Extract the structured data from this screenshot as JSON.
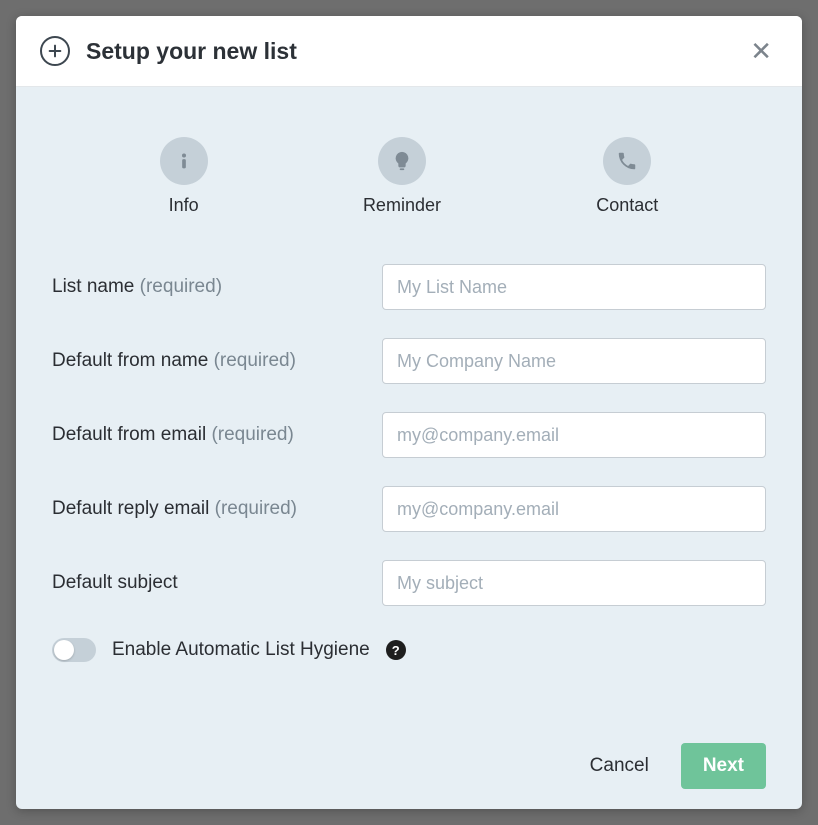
{
  "header": {
    "title": "Setup your new list"
  },
  "steps": [
    {
      "label": "Info",
      "icon": "info-icon"
    },
    {
      "label": "Reminder",
      "icon": "lightbulb-icon"
    },
    {
      "label": "Contact",
      "icon": "phone-icon"
    }
  ],
  "fields": {
    "list_name": {
      "label": "List name",
      "required_text": "(required)",
      "placeholder": "My List Name",
      "value": ""
    },
    "from_name": {
      "label": "Default from name",
      "required_text": "(required)",
      "placeholder": "My Company Name",
      "value": ""
    },
    "from_email": {
      "label": "Default from email",
      "required_text": "(required)",
      "placeholder": "my@company.email",
      "value": ""
    },
    "reply_email": {
      "label": "Default reply email",
      "required_text": "(required)",
      "placeholder": "my@company.email",
      "value": ""
    },
    "subject": {
      "label": "Default subject",
      "required_text": "",
      "placeholder": "My subject",
      "value": ""
    }
  },
  "toggle": {
    "label": "Enable Automatic List Hygiene",
    "enabled": false
  },
  "footer": {
    "cancel": "Cancel",
    "next": "Next"
  }
}
